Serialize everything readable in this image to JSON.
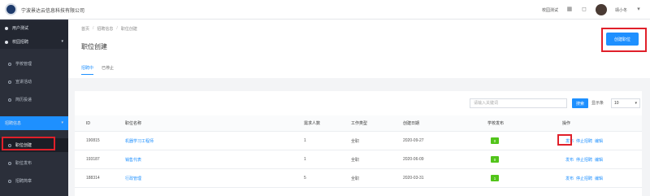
{
  "header": {
    "company": "宁波景达云信息科技有限公司",
    "switch_label": "校园测试",
    "user_name": "靖小冬"
  },
  "sidebar": {
    "items": [
      {
        "label": "用户测试",
        "type": "parent"
      },
      {
        "label": "校园招聘",
        "type": "parent"
      },
      {
        "label": "学校管理",
        "type": "sub"
      },
      {
        "label": "宣讲活动",
        "type": "sub"
      },
      {
        "label": "简历投递",
        "type": "sub"
      },
      {
        "label": "招聘信息",
        "type": "parent-active"
      },
      {
        "label": "职位创建",
        "type": "sub-active"
      },
      {
        "label": "职位发布",
        "type": "sub"
      },
      {
        "label": "招聘简章",
        "type": "sub"
      }
    ]
  },
  "breadcrumb": [
    "首页",
    "招聘信息",
    "职位创建"
  ],
  "page_title": "职位创建",
  "tabs": [
    {
      "label": "招聘中",
      "active": true
    },
    {
      "label": "已停止",
      "active": false
    }
  ],
  "create_button": "创建职位",
  "search": {
    "placeholder": "请输入关键词",
    "button": "搜索"
  },
  "per_page": {
    "label": "显示条",
    "value": "10"
  },
  "table": {
    "headers": [
      "ID",
      "职位名称",
      "需求人数",
      "工作类型",
      "创建日期",
      "学校发布",
      "操作"
    ],
    "rows": [
      {
        "id": "190815",
        "name": "机器学习工程师",
        "count": "1",
        "type": "全职",
        "date": "2020-09-27",
        "published": "0",
        "ops": [
          "发布",
          "停止招聘",
          "编辑"
        ]
      },
      {
        "id": "193187",
        "name": "销售代表",
        "count": "1",
        "type": "全职",
        "date": "2020-06-09",
        "published": "0",
        "ops": [
          "发布",
          "停止招聘",
          "编辑"
        ]
      },
      {
        "id": "188314",
        "name": "行政管理",
        "count": "5",
        "type": "全职",
        "date": "2020-03-31",
        "published": "1",
        "ops": [
          "发布",
          "停止招聘",
          "编辑"
        ]
      }
    ]
  },
  "colors": {
    "accent": "#1e90ff",
    "sidebar": "#2b2f3a",
    "highlight_box": "#e0202a",
    "badge": "#52c41a"
  }
}
